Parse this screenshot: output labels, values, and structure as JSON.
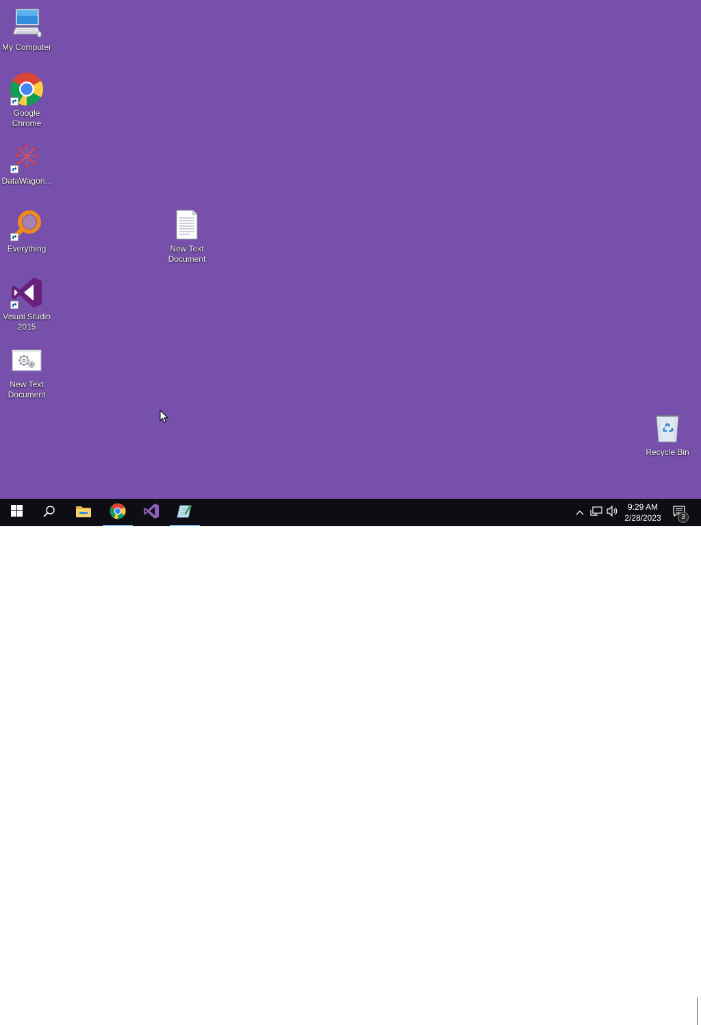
{
  "desktop": {
    "background_color": "#7650ab",
    "icons": [
      {
        "label": "My Computer",
        "icon": "computer-icon"
      },
      {
        "label": "Google Chrome",
        "icon": "chrome-icon",
        "shortcut": true
      },
      {
        "label": "DataWagon...",
        "icon": "datawagon-icon",
        "shortcut": true
      },
      {
        "label": "Everything",
        "icon": "everything-search-icon",
        "shortcut": true
      },
      {
        "label": "Visual Studio 2015",
        "icon": "visual-studio-icon",
        "shortcut": true
      },
      {
        "label": "New Text Document",
        "icon": "settings-document-icon"
      },
      {
        "label": "New Text Document",
        "icon": "text-document-icon"
      },
      {
        "label": "Recycle Bin",
        "icon": "recycle-bin-icon"
      }
    ]
  },
  "taskbar": {
    "background_color": "#0f0d14",
    "buttons": [
      {
        "name": "Start",
        "icon": "windows-logo-icon"
      },
      {
        "name": "Search",
        "icon": "search-icon"
      },
      {
        "name": "File Explorer",
        "icon": "folder-icon"
      },
      {
        "name": "Google Chrome",
        "icon": "chrome-icon",
        "active": true
      },
      {
        "name": "Visual Studio 2015",
        "icon": "visual-studio-icon"
      },
      {
        "name": "Notepad",
        "icon": "notepad-icon",
        "active": true
      }
    ],
    "tray": {
      "icons": [
        "chevron-up-icon",
        "network-icon",
        "volume-icon"
      ],
      "time": "9:29 AM",
      "date": "2/28/2023",
      "notification_count": "3"
    }
  }
}
